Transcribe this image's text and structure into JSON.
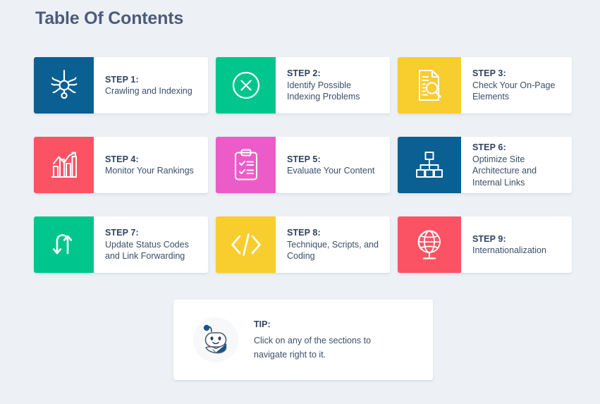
{
  "page": {
    "title": "Table Of Contents",
    "background_color": "#edf1f5",
    "title_color": "#4d5b7c"
  },
  "colors": {
    "dark_blue": "#0a5f93",
    "green": "#00c68d",
    "yellow": "#f8cd2e",
    "red": "#fb5364",
    "magenta": "#ec5cc8",
    "card_background": "#ffffff",
    "text": "#2f4260"
  },
  "steps": [
    {
      "label": "STEP 1:",
      "description": "Crawling and Indexing",
      "icon": "spider-crawler-icon",
      "color": "#0a5f93"
    },
    {
      "label": "STEP 2:",
      "description": "Identify Possible Indexing Problems",
      "icon": "circle-x-icon",
      "color": "#00c68d"
    },
    {
      "label": "STEP 3:",
      "description": "Check Your On-Page Elements",
      "icon": "document-magnifier-icon",
      "color": "#f8cd2e"
    },
    {
      "label": "STEP 4:",
      "description": "Monitor Your Rankings",
      "icon": "bar-chart-icon",
      "color": "#fb5364"
    },
    {
      "label": "STEP 5:",
      "description": "Evaluate Your Content",
      "icon": "clipboard-checklist-icon",
      "color": "#ec5cc8"
    },
    {
      "label": "STEP 6:",
      "description": "Optimize Site Architecture and Internal Links",
      "icon": "sitemap-hierarchy-icon",
      "color": "#0a5f93"
    },
    {
      "label": "STEP 7:",
      "description": "Update Status Codes and Link Forwarding",
      "icon": "redirect-arrows-icon",
      "color": "#00c68d"
    },
    {
      "label": "STEP 8:",
      "description": "Technique, Scripts, and Coding",
      "icon": "code-brackets-icon",
      "color": "#f8cd2e"
    },
    {
      "label": "STEP 9:",
      "description": "Internationalization",
      "icon": "globe-stand-icon",
      "color": "#fb5364"
    }
  ],
  "tip": {
    "heading": "TIP:",
    "body": "Click on any of the sections to navigate right to it.",
    "mascot_icon": "robot-mascot-icon"
  }
}
